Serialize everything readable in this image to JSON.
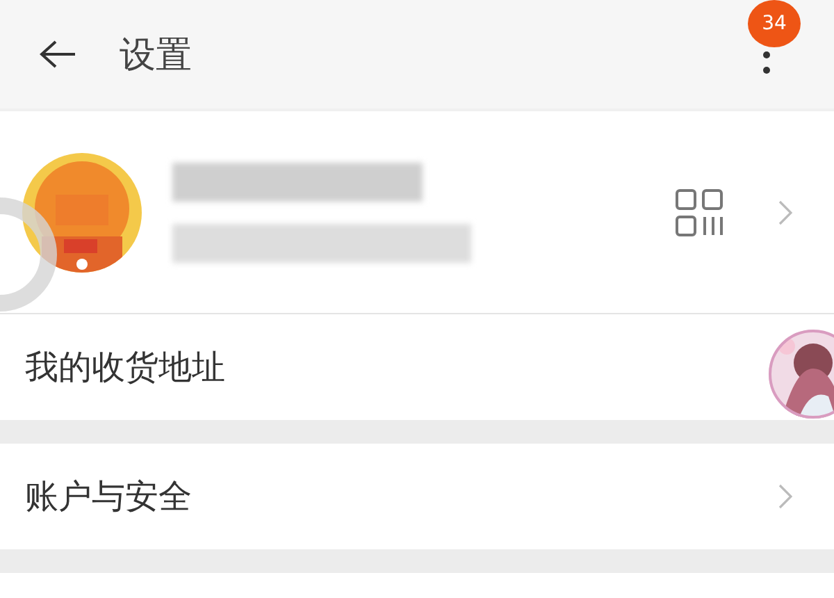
{
  "header": {
    "title": "设置",
    "badge": "34"
  },
  "rows": [
    {
      "label": "我的收货地址",
      "chevron": false
    },
    {
      "label": "账户与安全",
      "chevron": true
    }
  ]
}
